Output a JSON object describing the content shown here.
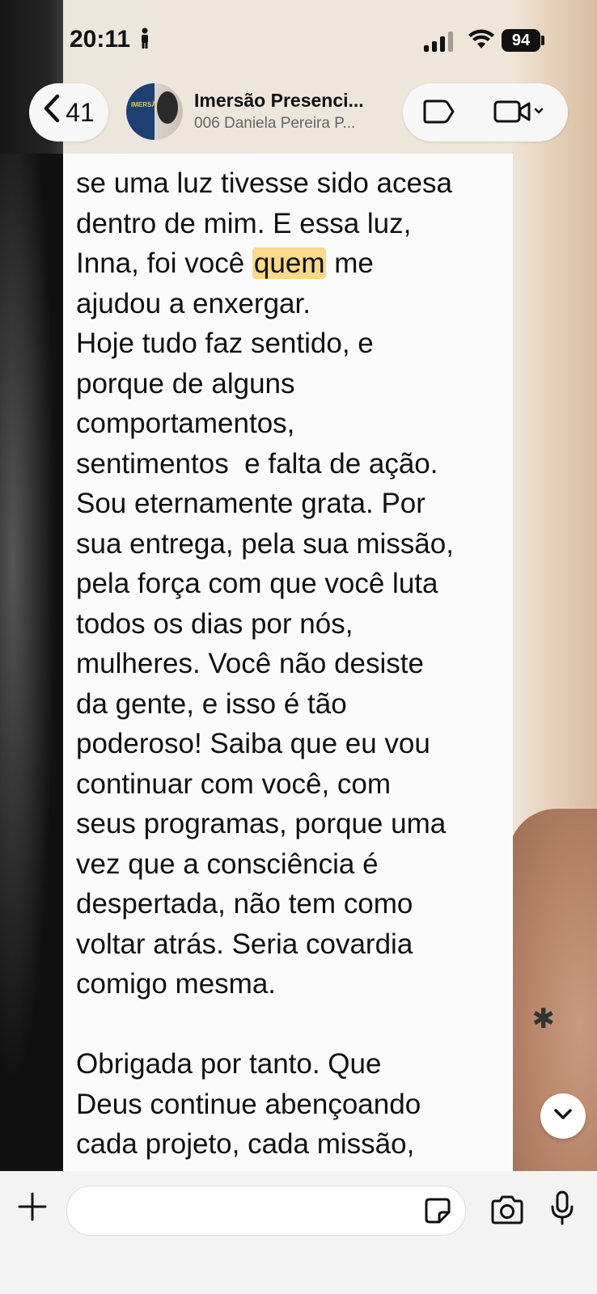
{
  "status_bar": {
    "time": "20:11",
    "battery": "94"
  },
  "header": {
    "back_count": "41",
    "title": "Imersão Presenci...",
    "subtitle": "006 Daniela Pereira P...",
    "avatar_text": "IMERSÃO"
  },
  "message": {
    "before": "se uma luz tivesse sido acesa\ndentro de mim. E essa luz,\nInna, foi você ",
    "highlight": "quem",
    "after": " me\najudou a enxergar.\nHoje tudo faz sentido, e\nporque de alguns\ncomportamentos,\nsentimentos  e falta de ação.\nSou eternamente grata. Por\nsua entrega, pela sua missão,\npela força com que você luta\ntodos os dias por nós,\nmulheres. Você não desiste\nda gente, e isso é tão\npoderoso! Saiba que eu vou\ncontinuar com você, com\nseus programas, porque uma\nvez que a consciência é\ndespertada, não tem como\nvoltar atrás. Seria covardia\ncomigo mesma.\n\nObrigada por tanto. Que\nDeus continue abençoando\ncada projeto, cada missão,"
  },
  "colors": {
    "highlight": "#f9d98a",
    "bubble": "#fbfbfb",
    "bar": "#f3f3f3"
  },
  "icons": {
    "back": "chevron-left-icon",
    "tag": "tag-icon",
    "video": "video-camera-icon",
    "scroll": "chevron-down-icon",
    "plus": "plus-icon",
    "sticker": "sticker-icon",
    "camera": "camera-icon",
    "mic": "microphone-icon"
  }
}
